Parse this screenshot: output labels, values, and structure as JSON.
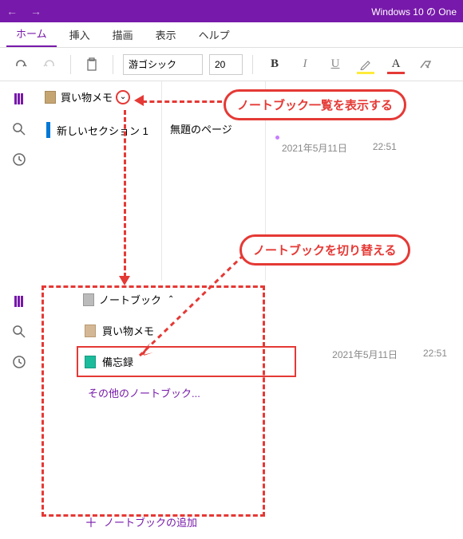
{
  "titlebar": {
    "title": "Windows 10 の One"
  },
  "ribbon": {
    "tabs": {
      "home": "ホーム",
      "insert": "挿入",
      "draw": "描画",
      "view": "表示",
      "help": "ヘルプ"
    },
    "font_name": "游ゴシック",
    "font_size": "20"
  },
  "notebook": {
    "current": "買い物メモ",
    "section": "新しいセクション 1",
    "page": "無題のページ",
    "date": "2021年5月11日",
    "time": "22:51"
  },
  "dropdown": {
    "header": "ノートブック",
    "items": [
      {
        "label": "買い物メモ",
        "color": "tan"
      },
      {
        "label": "備忘録",
        "color": "green"
      }
    ],
    "other": "その他のノートブック...",
    "add": "ノートブックの追加"
  },
  "annotations": {
    "callout1": "ノートブック一覧を表示する",
    "callout2": "ノートブックを切り替える"
  }
}
